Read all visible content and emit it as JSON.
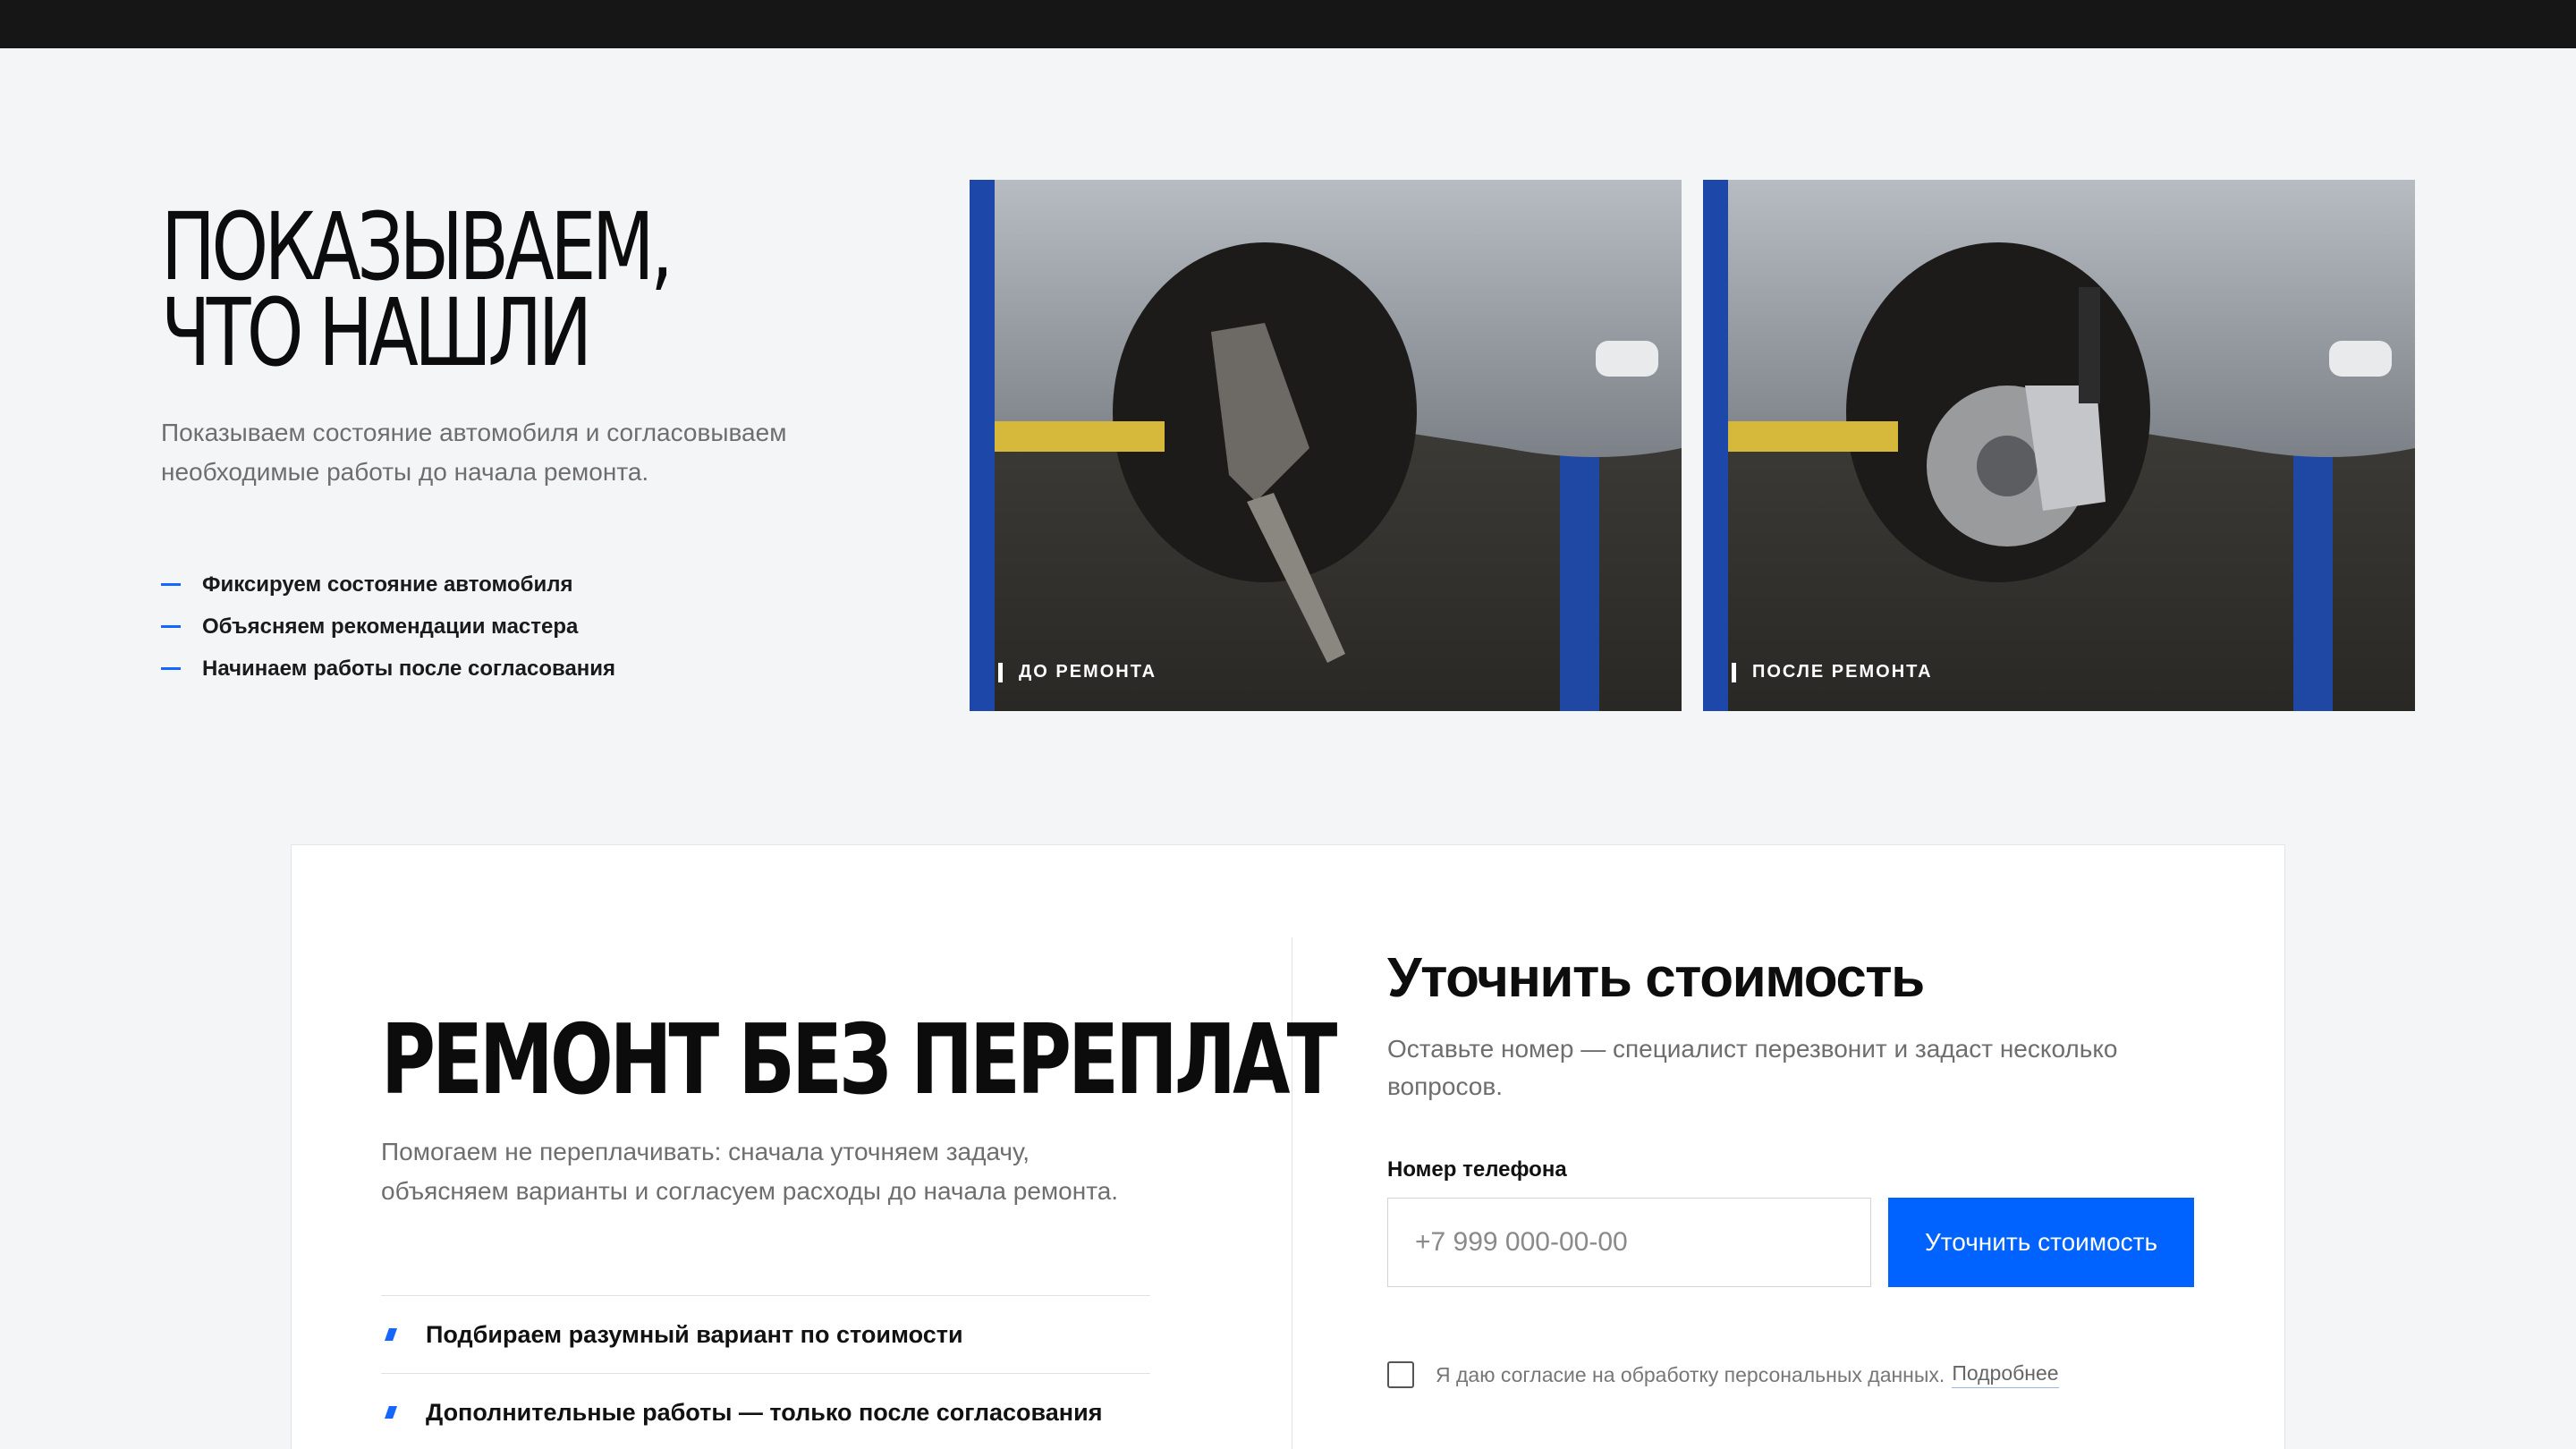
{
  "section_found": {
    "title_line1": "ПОКАЗЫВАЕМ,",
    "title_line2": "ЧТО НАШЛИ",
    "description": "Показываем состояние автомобиля и согласовываем необходимые работы до начала ремонта.",
    "items": [
      {
        "label": "Фиксируем состояние автомобиля"
      },
      {
        "label": "Объясняем рекомендации мастера"
      },
      {
        "label": "Начинаем работы после согласования"
      }
    ],
    "photos": [
      {
        "label": "ДО РЕМОНТА"
      },
      {
        "label": "ПОСЛЕ РЕМОНТА"
      }
    ]
  },
  "section_repair": {
    "title": "РЕМОНТ БЕЗ ПЕРЕПЛАТ",
    "description": "Помогаем не переплачивать: сначала уточняем задачу, объясняем варианты и согласуем расходы до начала ремонта.",
    "items": [
      {
        "label": "Подбираем разумный вариант по стоимости"
      },
      {
        "label": "Дополнительные работы — только после согласования"
      }
    ]
  },
  "form": {
    "title": "Уточнить стоимость",
    "subtitle": "Оставьте номер — специалист перезвонит и задаст несколько вопросов.",
    "phone_label": "Номер телефона",
    "phone_placeholder": "+7 999 000-00-00",
    "phone_value": "",
    "submit_label": "Уточнить стоимость",
    "consent_text": "Я даю согласие на обработку персональных данных.",
    "consent_link": "Подробнее",
    "consent_checked": false
  },
  "colors": {
    "accent": "#0062ff",
    "topbar": "#161616",
    "background": "#f4f5f7"
  }
}
